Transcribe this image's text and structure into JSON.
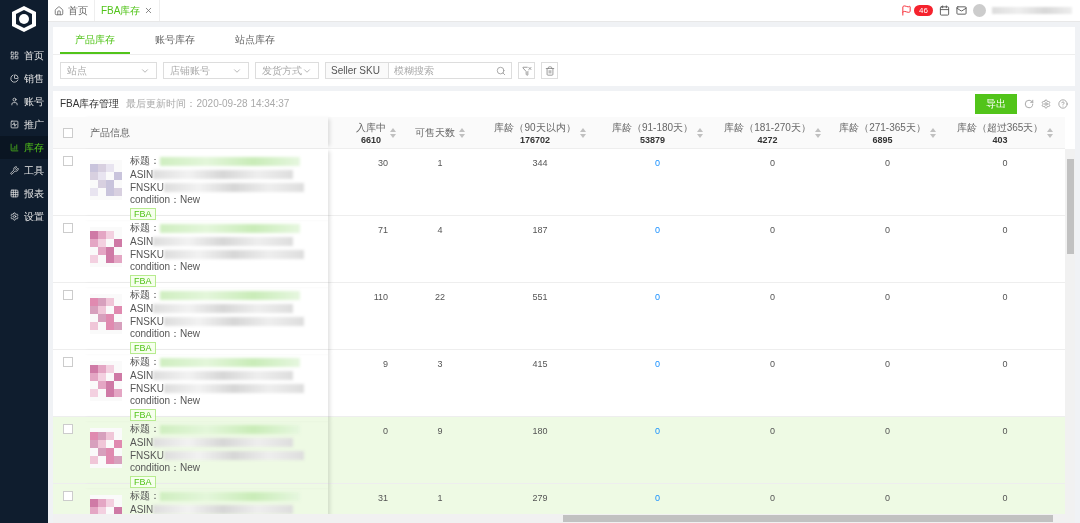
{
  "sidebar": {
    "items": [
      {
        "label": "首页",
        "selected": false
      },
      {
        "label": "销售",
        "selected": false
      },
      {
        "label": "账号",
        "selected": false
      },
      {
        "label": "推广",
        "selected": false
      },
      {
        "label": "库存",
        "selected": true
      },
      {
        "label": "工具",
        "selected": false
      },
      {
        "label": "报表",
        "selected": false
      },
      {
        "label": "设置",
        "selected": false
      }
    ]
  },
  "top_tabs": [
    {
      "label": "首页",
      "selected": false,
      "closable": false
    },
    {
      "label": "FBA库存",
      "selected": true,
      "closable": true
    }
  ],
  "header": {
    "notification_count": "46"
  },
  "inventory_tabs": [
    {
      "label": "产品库存",
      "selected": true
    },
    {
      "label": "账号库存",
      "selected": false
    },
    {
      "label": "站点库存",
      "selected": false
    }
  ],
  "filters": [
    {
      "kind": "select",
      "placeholder": "站点"
    },
    {
      "kind": "select",
      "placeholder": "店铺账号"
    },
    {
      "kind": "select",
      "placeholder": "发货方式"
    },
    {
      "kind": "search",
      "type_value": "Seller SKU",
      "placeholder": "模糊搜索"
    }
  ],
  "table": {
    "title": "FBA库存管理",
    "updated": "最后更新时间：2020-09-28 14:34:37",
    "export_label": "导出",
    "header_checked": false,
    "columns": [
      {
        "label": "产品信息"
      },
      {
        "label": "入库中",
        "total": "6610",
        "link": false
      },
      {
        "label": "可售天数",
        "link": false
      },
      {
        "label": "库龄（90天以内）",
        "total": "176702",
        "link": false
      },
      {
        "label": "库龄（91-180天）",
        "total": "53879",
        "link": true
      },
      {
        "label": "库龄（181-270天）",
        "total": "4272",
        "link": false
      },
      {
        "label": "库龄（271-365天）",
        "total": "6895",
        "link": false
      },
      {
        "label": "库龄（超过365天）",
        "total": "403",
        "link": false
      }
    ],
    "rows": [
      {
        "checked": false,
        "highlighted": false,
        "info": [
          {
            "label": "标题：",
            "redacted": true
          },
          {
            "label": "ASIN",
            "redacted": true
          },
          {
            "label": "FNSKU",
            "redacted": true
          },
          {
            "label": "condition：New",
            "redacted": false
          }
        ],
        "tag": "FBA",
        "values": [
          "30",
          "1",
          "344",
          "0",
          "0",
          "0",
          "0"
        ]
      },
      {
        "checked": false,
        "highlighted": false,
        "info": [
          {
            "label": "标题：",
            "redacted": true
          },
          {
            "label": "ASIN",
            "redacted": true
          },
          {
            "label": "FNSKU",
            "redacted": true
          },
          {
            "label": "condition：New",
            "redacted": false
          }
        ],
        "tag": "FBA",
        "values": [
          "71",
          "4",
          "187",
          "0",
          "0",
          "0",
          "0"
        ]
      },
      {
        "checked": false,
        "highlighted": false,
        "info": [
          {
            "label": "标题：",
            "redacted": true
          },
          {
            "label": "ASIN",
            "redacted": true
          },
          {
            "label": "FNSKU",
            "redacted": true
          },
          {
            "label": "condition：New",
            "redacted": false
          }
        ],
        "tag": "FBA",
        "values": [
          "110",
          "22",
          "551",
          "0",
          "0",
          "0",
          "0"
        ]
      },
      {
        "checked": false,
        "highlighted": false,
        "info": [
          {
            "label": "标题：",
            "redacted": true
          },
          {
            "label": "ASIN",
            "redacted": true
          },
          {
            "label": "FNSKU",
            "redacted": true
          },
          {
            "label": "condition：New",
            "redacted": false
          }
        ],
        "tag": "FBA",
        "values": [
          "9",
          "3",
          "415",
          "0",
          "0",
          "0",
          "0"
        ]
      },
      {
        "checked": false,
        "highlighted": true,
        "info": [
          {
            "label": "标题：",
            "redacted": true
          },
          {
            "label": "ASIN",
            "redacted": true
          },
          {
            "label": "FNSKU",
            "redacted": true
          },
          {
            "label": "condition：New",
            "redacted": false
          }
        ],
        "tag": "FBA",
        "values": [
          "0",
          "9",
          "180",
          "0",
          "0",
          "0",
          "0"
        ]
      },
      {
        "checked": false,
        "highlighted": true,
        "info": [
          {
            "label": "标题：",
            "redacted": true
          },
          {
            "label": "ASIN",
            "redacted": true
          }
        ],
        "values": [
          "31",
          "1",
          "279",
          "0",
          "0",
          "0",
          "0"
        ]
      }
    ]
  }
}
